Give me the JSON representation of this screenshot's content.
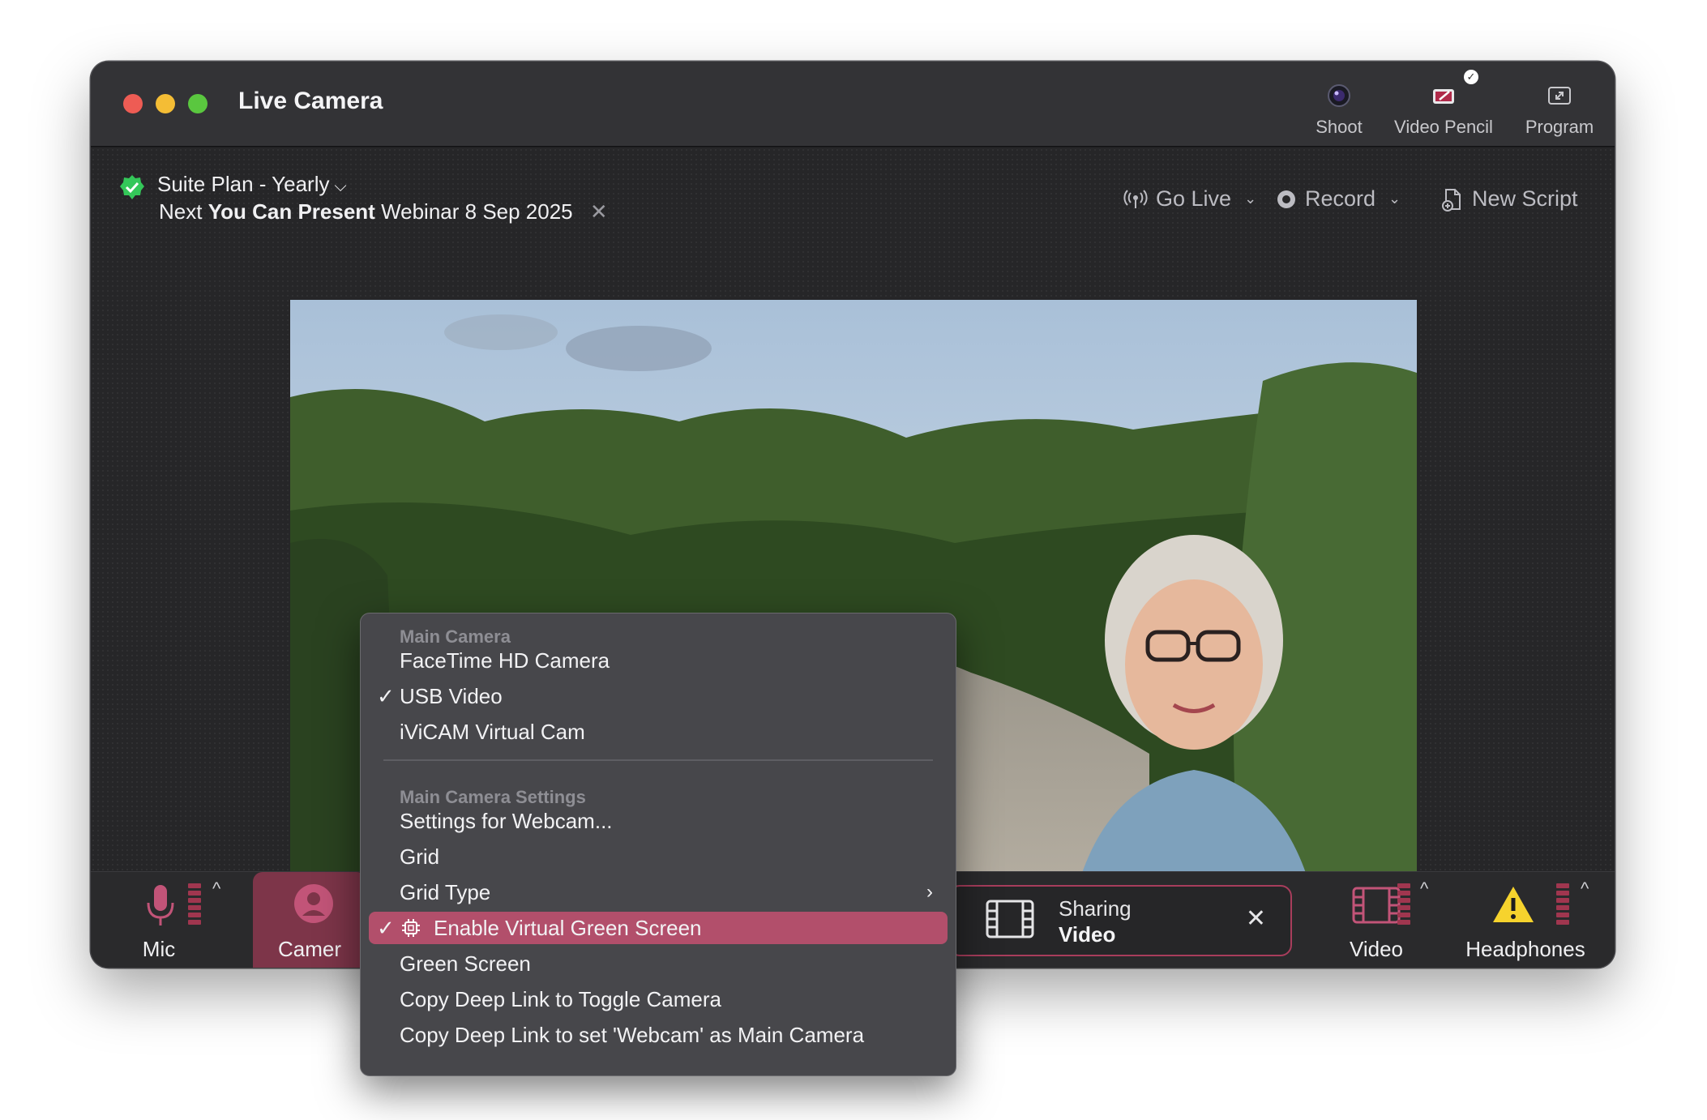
{
  "window": {
    "title": "Live Camera",
    "toolbar": [
      {
        "label": "Shoot",
        "icon": "camera-lens-icon"
      },
      {
        "label": "Video Pencil",
        "icon": "video-pencil-icon",
        "badge": "✓"
      },
      {
        "label": "Program",
        "icon": "expand-icon"
      }
    ]
  },
  "subbar": {
    "plan": "Suite Plan - Yearly",
    "plan_chevron": "⌵",
    "next_prefix": "Next",
    "next_bold": "You Can Present",
    "next_suffix": "Webinar 8 Sep 2025",
    "next_close": "✕",
    "go_live": "Go Live",
    "record": "Record",
    "new_script": "New Script",
    "dropdown_glyph": "⌄"
  },
  "bottom": {
    "mic": "Mic",
    "camera": "Camer",
    "sharing_line1": "Sharing",
    "sharing_line2": "Video",
    "sharing_close": "✕",
    "video": "Video",
    "headphones": "Headphones",
    "caret": "^"
  },
  "menu": {
    "header_main": "Main Camera",
    "items_camera": [
      "FaceTime HD Camera",
      "USB Video",
      "iViCAM Virtual Cam"
    ],
    "checked_camera": "USB Video",
    "header_settings": "Main Camera Settings",
    "settings_webcam": "Settings for Webcam...",
    "grid": "Grid",
    "grid_type": "Grid Type",
    "enable_vgs": "Enable Virtual Green Screen",
    "green_screen": "Green Screen",
    "copy_toggle": "Copy Deep Link to Toggle Camera",
    "copy_main": "Copy Deep Link to set 'Webcam' as Main Camera",
    "check_glyph": "✓",
    "submenu_glyph": "›"
  },
  "colors": {
    "accent": "#b24f6b",
    "accent_dark": "#7d3549",
    "meter": "#a0364f",
    "plan_check": "#34c759",
    "warning": "#f6d32d"
  }
}
